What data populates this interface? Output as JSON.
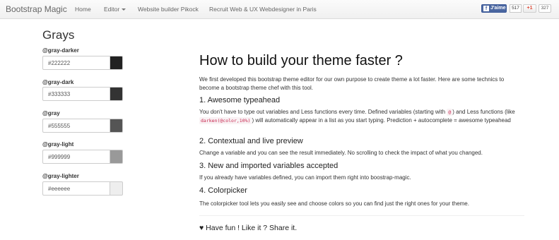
{
  "navbar": {
    "brand": "Bootstrap Magic",
    "links": [
      "Home",
      "Editor",
      "Website builder Pikock",
      "Recruit Web & UX Webdesigner in Paris"
    ],
    "fb_label": "J'aime",
    "fb_count": "517",
    "gplus_label": "+1",
    "gplus_count": "327"
  },
  "sidebar": {
    "title": "Grays",
    "variables": [
      {
        "name": "@gray-darker",
        "value": "#222222",
        "color": "#222222"
      },
      {
        "name": "@gray-dark",
        "value": "#333333",
        "color": "#333333"
      },
      {
        "name": "@gray",
        "value": "#555555",
        "color": "#555555"
      },
      {
        "name": "@gray-light",
        "value": "#999999",
        "color": "#999999"
      },
      {
        "name": "@gray-lighter",
        "value": "#eeeeee",
        "color": "#eeeeee"
      }
    ]
  },
  "main": {
    "title": "How to build your theme faster ?",
    "intro": "We first developed this bootstrap theme editor for our own purpose to create theme a lot faster. Here are some technics to become a bootstrap theme chef with this tool.",
    "sections": [
      {
        "heading": "1. Awesome typeahead",
        "text_a": "You don't have to type out variables and Less functions every time. Defined variables (starting with ",
        "code_a": "@",
        "text_b": ") and Less functions (like ",
        "code_b": "darken(@color,10%)",
        "text_c": ") will automatically appear in a list as you start typing. Prediction + autocomplete = awesome typeahead"
      },
      {
        "heading": "2. Contextual and live preview",
        "text": "Change a variable and you can see the result immediately. No scrolling to check the impact of what you changed."
      },
      {
        "heading": "3. New and imported variables accepted",
        "text": "If you already have variables defined, you can import them right into boostrap-magic."
      },
      {
        "heading": "4. Colorpicker",
        "text": "The colorpicker tool lets you easily see and choose colors so you can find just the right ones for your theme."
      }
    ],
    "footer": "♥ Have fun ! Like it ? Share it."
  }
}
